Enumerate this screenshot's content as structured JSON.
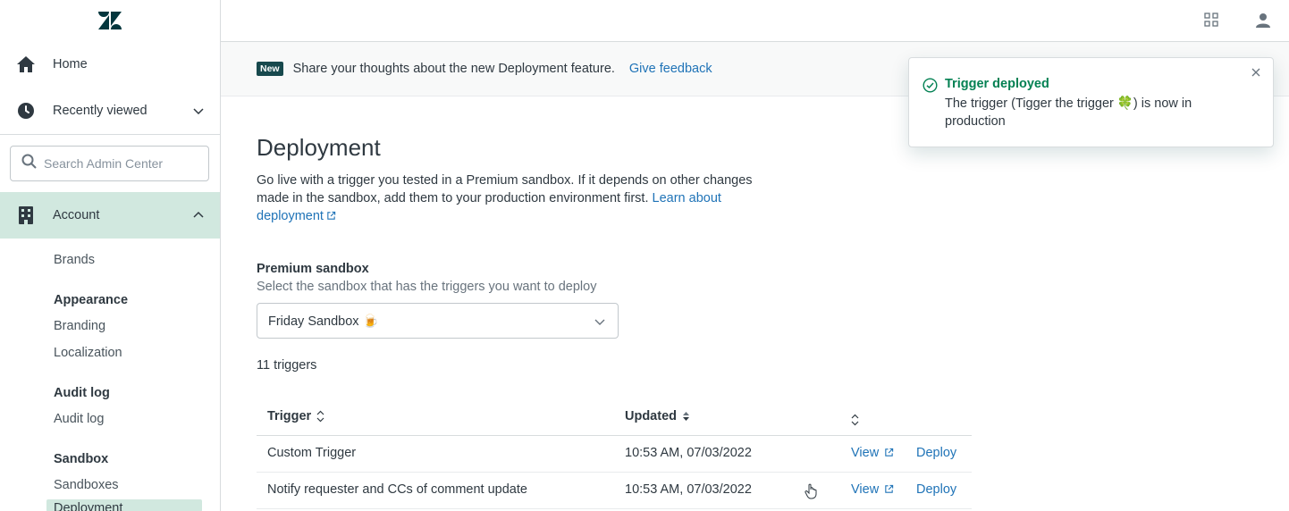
{
  "sidebar": {
    "home": "Home",
    "recently_viewed": "Recently viewed",
    "search_placeholder": "Search Admin Center",
    "account": "Account",
    "sections": [
      {
        "heading": null,
        "links": [
          "Brands"
        ]
      },
      {
        "heading": "Appearance",
        "links": [
          "Branding",
          "Localization"
        ]
      },
      {
        "heading": "Audit log",
        "links": [
          "Audit log"
        ]
      },
      {
        "heading": "Sandbox",
        "links": [
          "Sandboxes"
        ]
      }
    ],
    "selected_item": "Deployment"
  },
  "banner": {
    "badge": "New",
    "text": "Share your thoughts about the new Deployment feature.",
    "link": "Give feedback"
  },
  "page": {
    "title": "Deployment",
    "intro_text": "Go live with a trigger you tested in a Premium sandbox. If it depends on other changes made in the sandbox, add them to your production environment first.",
    "learn_more": "Learn about deployment",
    "field_label": "Premium sandbox",
    "field_hint": "Select the sandbox that has the triggers you want to deploy",
    "selected_sandbox": "Friday Sandbox 🍺",
    "trigger_count": "11 triggers"
  },
  "table": {
    "headers": {
      "trigger": "Trigger",
      "updated": "Updated"
    },
    "rows": [
      {
        "trigger": "Custom Trigger",
        "updated": "10:53 AM, 07/03/2022",
        "view": "View",
        "deploy": "Deploy"
      },
      {
        "trigger": "Notify requester and CCs of comment update",
        "updated": "10:53 AM, 07/03/2022",
        "view": "View",
        "deploy": "Deploy"
      }
    ]
  },
  "toast": {
    "title": "Trigger deployed",
    "body": "The trigger (Tigger the trigger 🍀) is now in production"
  },
  "icons": {
    "logo": "zendesk-logo",
    "home": "home-icon",
    "clock": "clock-icon",
    "building": "building-icon",
    "apps": "apps-grid-icon",
    "user": "user-icon",
    "success": "check-circle-icon"
  },
  "colors": {
    "accent_green": "#038153",
    "link_blue": "#1f73b7",
    "active_bg": "#d1e8df",
    "badge_bg": "#17494d"
  }
}
